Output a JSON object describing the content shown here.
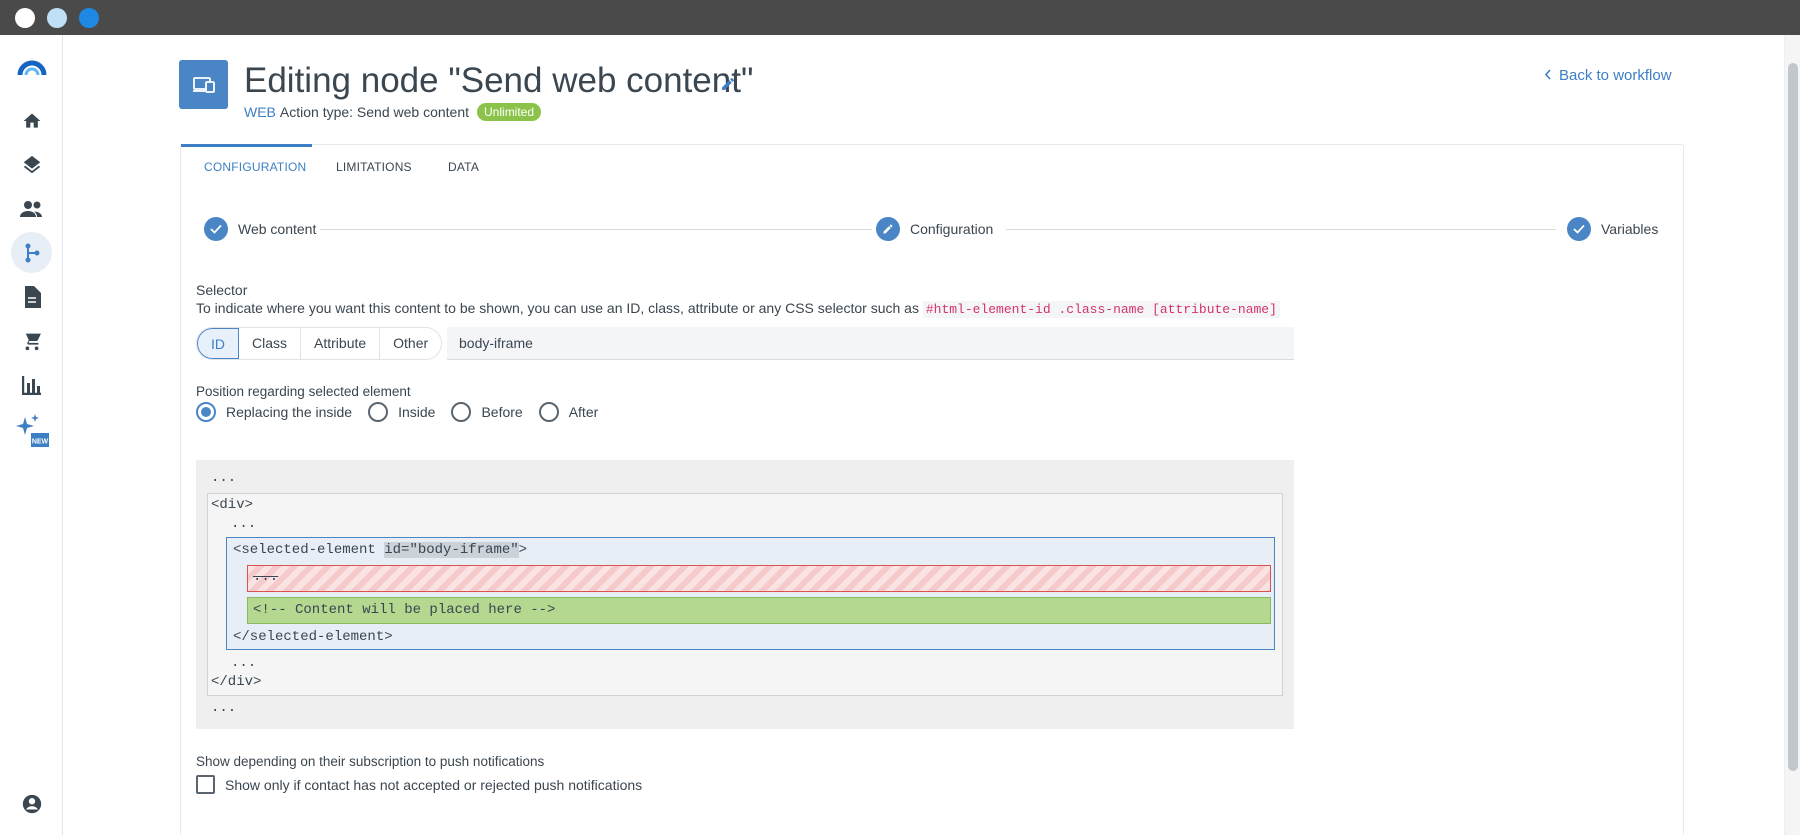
{
  "window": {
    "dots": [
      "#ffffff",
      "#bfe0f7",
      "#1e88e5"
    ]
  },
  "sidebar": {
    "items": [
      {
        "icon": "logo-icon"
      },
      {
        "icon": "home-icon"
      },
      {
        "icon": "layers-icon"
      },
      {
        "icon": "contacts-icon"
      },
      {
        "icon": "workflow-icon",
        "active": true
      },
      {
        "icon": "document-icon"
      },
      {
        "icon": "cart-icon"
      },
      {
        "icon": "chart-icon"
      },
      {
        "icon": "ai-sparkle-icon",
        "badge": "NEW"
      },
      {
        "icon": "account-icon"
      }
    ]
  },
  "header": {
    "title": "Editing node \"Send web content\"",
    "channel": "WEB",
    "action_type": "Action type: Send web content",
    "badge": "Unlimited",
    "back_link": "Back to workflow"
  },
  "tabs": {
    "configuration": "CONFIGURATION",
    "limitations": "LIMITATIONS",
    "data": "DATA",
    "active": "CONFIGURATION"
  },
  "steps": {
    "web_content": "Web content",
    "configuration": "Configuration",
    "variables": "Variables"
  },
  "selector": {
    "title": "Selector",
    "description": "To indicate where you want this content to be shown, you can use an ID, class, attribute or any CSS selector such as",
    "example": "#html-element-id .class-name [attribute-name]",
    "options": [
      "ID",
      "Class",
      "Attribute",
      "Other"
    ],
    "selected": "ID",
    "value": "body-iframe"
  },
  "position": {
    "title": "Position regarding selected element",
    "options": [
      "Replacing the inside",
      "Inside",
      "Before",
      "After"
    ],
    "selected": "Replacing the inside"
  },
  "preview": {
    "dots": "...",
    "div_open": "<div>",
    "selected_open_prefix": "<selected-element ",
    "selected_attr": "id=\"body-iframe\"",
    "selected_open_suffix": ">",
    "removed": "...",
    "placeholder_comment": "<!-- Content will be placed here -->",
    "selected_close": "</selected-element>",
    "div_close": "</div>"
  },
  "push": {
    "title": "Show depending on their subscription to push notifications",
    "checkbox_label": "Show only if contact has not accepted or rejected push notifications",
    "checked": false
  },
  "colors": {
    "accent": "#4a86c5",
    "link": "#3d7fc4",
    "badge": "#8bc34a"
  }
}
